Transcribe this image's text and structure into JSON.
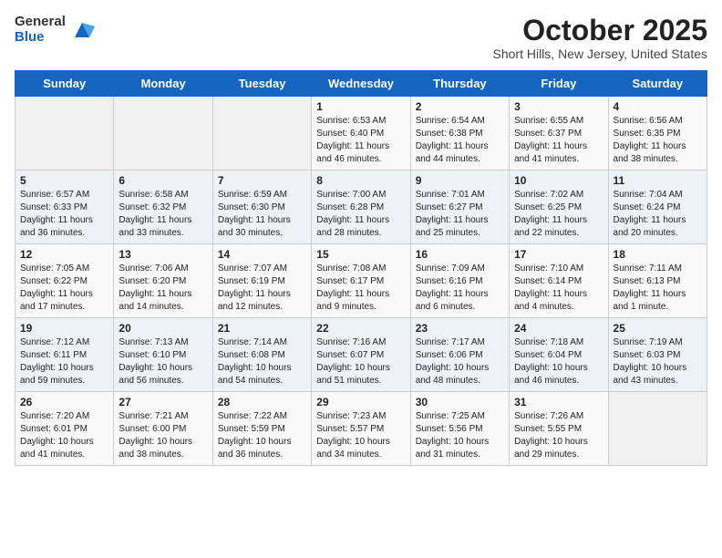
{
  "header": {
    "logo": {
      "general": "General",
      "blue": "Blue"
    },
    "title": "October 2025",
    "location": "Short Hills, New Jersey, United States"
  },
  "weekdays": [
    "Sunday",
    "Monday",
    "Tuesday",
    "Wednesday",
    "Thursday",
    "Friday",
    "Saturday"
  ],
  "weeks": [
    [
      {
        "day": "",
        "info": ""
      },
      {
        "day": "",
        "info": ""
      },
      {
        "day": "",
        "info": ""
      },
      {
        "day": "1",
        "info": "Sunrise: 6:53 AM\nSunset: 6:40 PM\nDaylight: 11 hours\nand 46 minutes."
      },
      {
        "day": "2",
        "info": "Sunrise: 6:54 AM\nSunset: 6:38 PM\nDaylight: 11 hours\nand 44 minutes."
      },
      {
        "day": "3",
        "info": "Sunrise: 6:55 AM\nSunset: 6:37 PM\nDaylight: 11 hours\nand 41 minutes."
      },
      {
        "day": "4",
        "info": "Sunrise: 6:56 AM\nSunset: 6:35 PM\nDaylight: 11 hours\nand 38 minutes."
      }
    ],
    [
      {
        "day": "5",
        "info": "Sunrise: 6:57 AM\nSunset: 6:33 PM\nDaylight: 11 hours\nand 36 minutes."
      },
      {
        "day": "6",
        "info": "Sunrise: 6:58 AM\nSunset: 6:32 PM\nDaylight: 11 hours\nand 33 minutes."
      },
      {
        "day": "7",
        "info": "Sunrise: 6:59 AM\nSunset: 6:30 PM\nDaylight: 11 hours\nand 30 minutes."
      },
      {
        "day": "8",
        "info": "Sunrise: 7:00 AM\nSunset: 6:28 PM\nDaylight: 11 hours\nand 28 minutes."
      },
      {
        "day": "9",
        "info": "Sunrise: 7:01 AM\nSunset: 6:27 PM\nDaylight: 11 hours\nand 25 minutes."
      },
      {
        "day": "10",
        "info": "Sunrise: 7:02 AM\nSunset: 6:25 PM\nDaylight: 11 hours\nand 22 minutes."
      },
      {
        "day": "11",
        "info": "Sunrise: 7:04 AM\nSunset: 6:24 PM\nDaylight: 11 hours\nand 20 minutes."
      }
    ],
    [
      {
        "day": "12",
        "info": "Sunrise: 7:05 AM\nSunset: 6:22 PM\nDaylight: 11 hours\nand 17 minutes."
      },
      {
        "day": "13",
        "info": "Sunrise: 7:06 AM\nSunset: 6:20 PM\nDaylight: 11 hours\nand 14 minutes."
      },
      {
        "day": "14",
        "info": "Sunrise: 7:07 AM\nSunset: 6:19 PM\nDaylight: 11 hours\nand 12 minutes."
      },
      {
        "day": "15",
        "info": "Sunrise: 7:08 AM\nSunset: 6:17 PM\nDaylight: 11 hours\nand 9 minutes."
      },
      {
        "day": "16",
        "info": "Sunrise: 7:09 AM\nSunset: 6:16 PM\nDaylight: 11 hours\nand 6 minutes."
      },
      {
        "day": "17",
        "info": "Sunrise: 7:10 AM\nSunset: 6:14 PM\nDaylight: 11 hours\nand 4 minutes."
      },
      {
        "day": "18",
        "info": "Sunrise: 7:11 AM\nSunset: 6:13 PM\nDaylight: 11 hours\nand 1 minute."
      }
    ],
    [
      {
        "day": "19",
        "info": "Sunrise: 7:12 AM\nSunset: 6:11 PM\nDaylight: 10 hours\nand 59 minutes."
      },
      {
        "day": "20",
        "info": "Sunrise: 7:13 AM\nSunset: 6:10 PM\nDaylight: 10 hours\nand 56 minutes."
      },
      {
        "day": "21",
        "info": "Sunrise: 7:14 AM\nSunset: 6:08 PM\nDaylight: 10 hours\nand 54 minutes."
      },
      {
        "day": "22",
        "info": "Sunrise: 7:16 AM\nSunset: 6:07 PM\nDaylight: 10 hours\nand 51 minutes."
      },
      {
        "day": "23",
        "info": "Sunrise: 7:17 AM\nSunset: 6:06 PM\nDaylight: 10 hours\nand 48 minutes."
      },
      {
        "day": "24",
        "info": "Sunrise: 7:18 AM\nSunset: 6:04 PM\nDaylight: 10 hours\nand 46 minutes."
      },
      {
        "day": "25",
        "info": "Sunrise: 7:19 AM\nSunset: 6:03 PM\nDaylight: 10 hours\nand 43 minutes."
      }
    ],
    [
      {
        "day": "26",
        "info": "Sunrise: 7:20 AM\nSunset: 6:01 PM\nDaylight: 10 hours\nand 41 minutes."
      },
      {
        "day": "27",
        "info": "Sunrise: 7:21 AM\nSunset: 6:00 PM\nDaylight: 10 hours\nand 38 minutes."
      },
      {
        "day": "28",
        "info": "Sunrise: 7:22 AM\nSunset: 5:59 PM\nDaylight: 10 hours\nand 36 minutes."
      },
      {
        "day": "29",
        "info": "Sunrise: 7:23 AM\nSunset: 5:57 PM\nDaylight: 10 hours\nand 34 minutes."
      },
      {
        "day": "30",
        "info": "Sunrise: 7:25 AM\nSunset: 5:56 PM\nDaylight: 10 hours\nand 31 minutes."
      },
      {
        "day": "31",
        "info": "Sunrise: 7:26 AM\nSunset: 5:55 PM\nDaylight: 10 hours\nand 29 minutes."
      },
      {
        "day": "",
        "info": ""
      }
    ]
  ]
}
